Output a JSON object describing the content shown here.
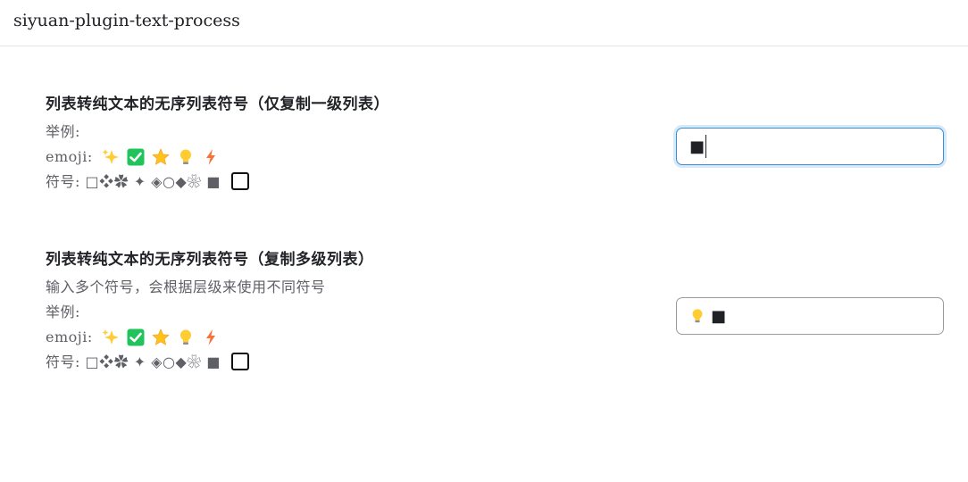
{
  "window": {
    "title": "siyuan-plugin-text-process"
  },
  "settings": [
    {
      "title": "列表转纯文本的无序列表符号（仅复制一级列表）",
      "description": "",
      "example_label": "举例:",
      "emoji_label": "emoji:",
      "emoji_icons": [
        "sparkles-icon",
        "check-box-icon",
        "star-icon",
        "light-bulb-icon",
        "lightning-icon"
      ],
      "symbols_label": "符号:",
      "symbols_text": "□❖✿ ✦ ◈○◆❀ ■",
      "input_value": "■"
    },
    {
      "title": "列表转纯文本的无序列表符号（复制多级列表）",
      "description": "输入多个符号，会根据层级来使用不同符号",
      "example_label": "举例:",
      "emoji_label": "emoji:",
      "emoji_icons": [
        "sparkles-icon",
        "check-box-icon",
        "star-icon",
        "light-bulb-icon",
        "lightning-icon"
      ],
      "symbols_label": "符号:",
      "symbols_text": "□❖✿ ✦ ◈○◆❀ ■",
      "input_value": "■"
    }
  ],
  "colors": {
    "focus_border": "#3b8fd6",
    "emoji_green": "#21c35b",
    "emoji_yellow": "#ffcc33",
    "emoji_orange": "#f7733a"
  }
}
